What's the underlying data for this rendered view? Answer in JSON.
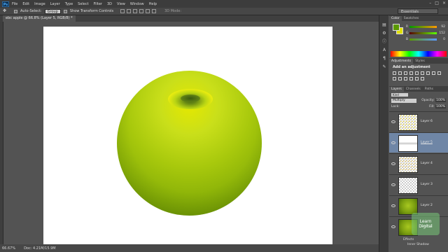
{
  "menubar": {
    "logo": "Ps",
    "items": [
      "File",
      "Edit",
      "Image",
      "Layer",
      "Type",
      "Select",
      "Filter",
      "3D",
      "View",
      "Window",
      "Help"
    ]
  },
  "options": {
    "auto_select_label": "Auto-Select:",
    "auto_select_value": "Group",
    "show_transform_label": "Show Transform Controls",
    "mode_3d_label": "3D Mode:"
  },
  "workspace": {
    "essentials_label": "Essentials"
  },
  "document": {
    "tab_title": "ebc apple @ 66.8% (Layer 5, RGB/8) *",
    "zoom": "66.67%",
    "doc_size": "Doc: 4.21M/15.9M"
  },
  "color_panel": {
    "tabs": [
      "Color",
      "Swatches"
    ],
    "foreground_color": "#5a9800",
    "background_color": "#e0e000",
    "sliders": [
      {
        "label": "R",
        "value": "92"
      },
      {
        "label": "G",
        "value": "152"
      },
      {
        "label": "B",
        "value": "0"
      }
    ]
  },
  "adjustments_panel": {
    "tabs": [
      "Adjustments",
      "Styles"
    ],
    "title": "Add an adjustment"
  },
  "layers_panel": {
    "tabs": [
      "Layers",
      "Channels",
      "Paths"
    ],
    "kind_filter": "Kind",
    "blend_mode": "Multiply",
    "opacity_label": "Opacity:",
    "opacity_value": "100%",
    "lock_label": "Lock:",
    "fill_label": "Fill:",
    "fill_value": "100%",
    "layers": [
      {
        "name": "Layer 6",
        "selected": false
      },
      {
        "name": "Layer 5",
        "selected": true
      },
      {
        "name": "Layer 4",
        "selected": false
      },
      {
        "name": "Layer 3",
        "selected": false
      },
      {
        "name": "Layer 2",
        "selected": false
      },
      {
        "name": "Layer 1",
        "selected": false
      }
    ],
    "effects_label": "Effects",
    "inner_shadow_label": "Inner Shadow"
  },
  "watermark": {
    "line1": "Learn",
    "line2": "Digital"
  }
}
